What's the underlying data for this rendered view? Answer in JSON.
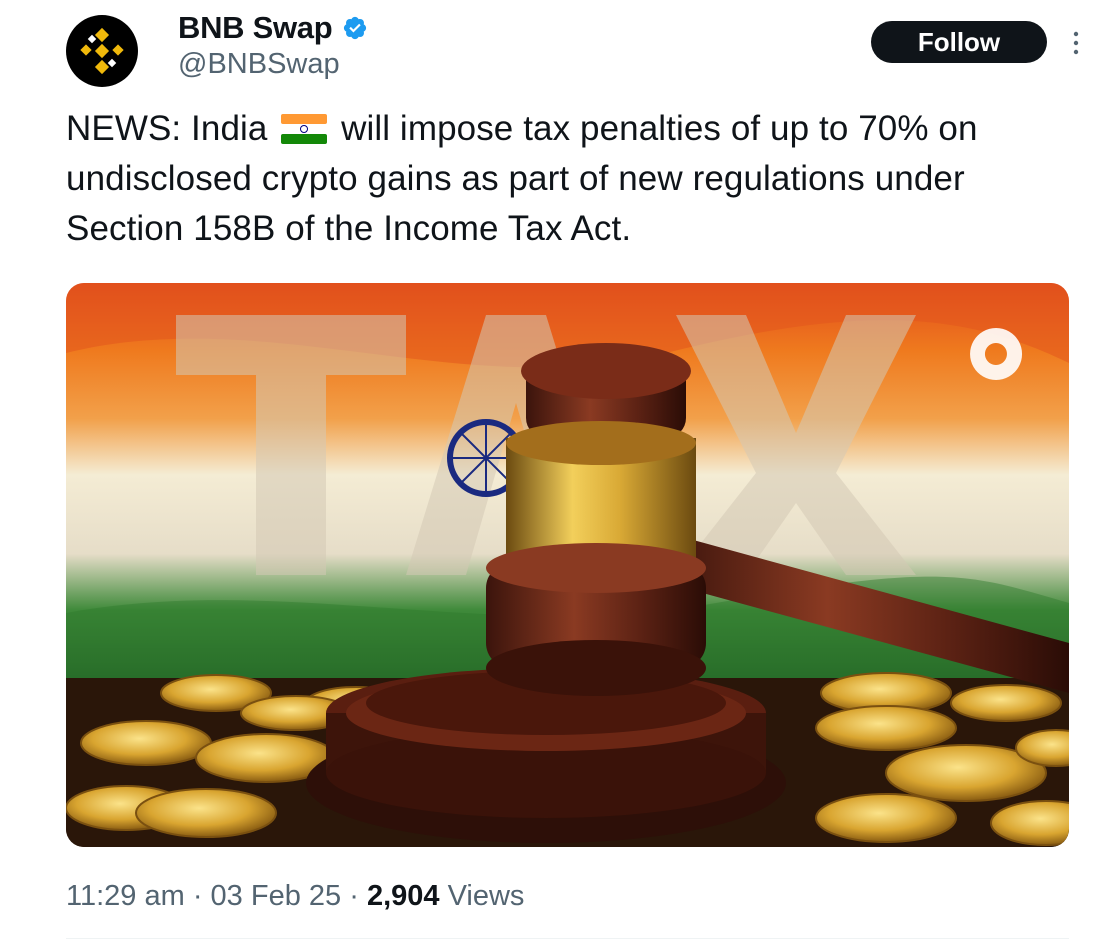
{
  "author": {
    "display_name": "BNB Swap",
    "handle": "@BNBSwap",
    "avatar_icon": "bnb-logo-icon",
    "verified_icon": "verified-badge-icon",
    "verified_color": "#1d9bf0"
  },
  "actions": {
    "follow_label": "Follow",
    "more_icon": "more-options-icon"
  },
  "tweet": {
    "text_before_flag": "NEWS: India",
    "flag_icon": "india-flag-icon",
    "text_after_flag": "will impose tax penalties of up to 70% on undisclosed crypto gains as part of new regulations under Section 158B of the Income Tax Act.",
    "image": {
      "alt_description_icon": "gavel-tax-image",
      "overlay_text": "TAX"
    }
  },
  "meta": {
    "time": "11:29 am",
    "sep1": " · ",
    "date": "03 Feb 25",
    "sep2": " · ",
    "views_count": "2,904",
    "views_label": "Views"
  },
  "colors": {
    "text_primary": "#0f1419",
    "text_secondary": "#536471",
    "follow_bg": "#0f1419",
    "bnb_gold": "#f0b90b"
  }
}
